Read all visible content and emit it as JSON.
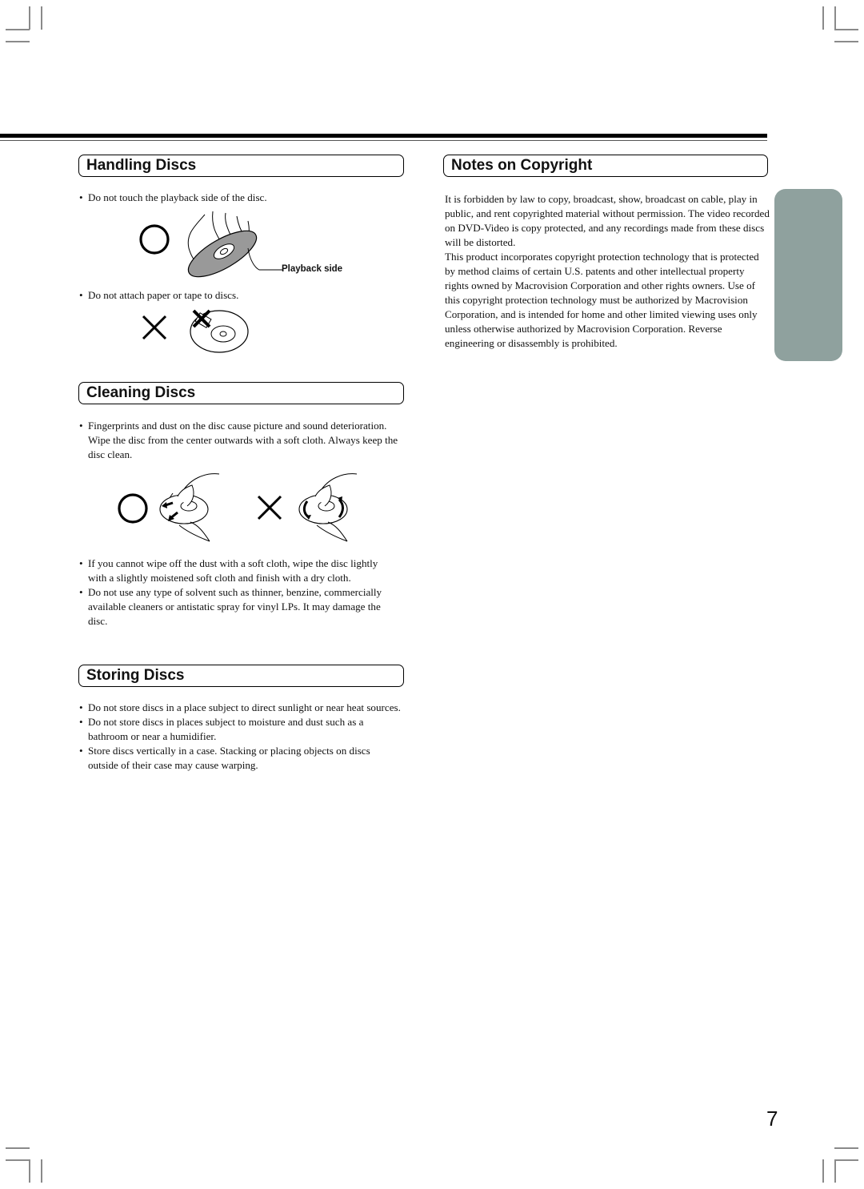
{
  "page": {
    "number": "7"
  },
  "left_column": {
    "handling": {
      "title": "Handling Discs",
      "bullet_1": "Do not touch the playback side of the disc.",
      "figure_1": {
        "ok_symbol": "circle-ok-icon",
        "label": "Playback side"
      },
      "bullet_2": "Do not attach paper or tape to discs.",
      "figure_2": {
        "ng_symbol": "cross-ng-icon"
      }
    },
    "cleaning": {
      "title": "Cleaning Discs",
      "bullets_top": [
        "Fingerprints and dust on the disc cause picture and sound deterioration. Wipe the disc from the center outwards with a soft cloth. Always keep the disc clean."
      ],
      "figure": {
        "ok_symbol": "circle-ok-icon",
        "ng_symbol": "cross-ng-icon"
      },
      "bullets_bottom": [
        "If you cannot wipe off the dust with a soft cloth, wipe the disc lightly with a slightly moistened soft cloth and finish with a dry cloth.",
        "Do not use any type of solvent such as thinner, benzine, commercially available cleaners or antistatic spray for vinyl LPs. It may damage the disc."
      ]
    },
    "storing": {
      "title": "Storing Discs",
      "bullets": [
        "Do not store discs in a place subject to direct sunlight or near heat sources.",
        "Do not store discs in places subject to moisture and dust such as a bathroom or near a humidifier.",
        "Store discs vertically in a case. Stacking or placing objects on discs outside of their case may cause warping."
      ]
    }
  },
  "right_column": {
    "copyright": {
      "title": "Notes on Copyright",
      "paragraph_1": "It is forbidden by law to copy, broadcast, show, broadcast on cable, play in public, and rent copyrighted material without permission. The video recorded on DVD-Video is copy protected, and any recordings made from these discs will be distorted.",
      "paragraph_2": "This product incorporates copyright protection technology that is protected by method claims of certain U.S. patents and other intellectual property rights owned by Macrovision Corporation and other rights owners. Use of this copyright protection technology must be authorized by Macrovision Corporation, and is intended for home and other limited viewing uses only unless otherwise authorized by Macrovision Corporation. Reverse engineering or disassembly is prohibited."
    }
  },
  "colors": {
    "side_tab": "#8fa19e",
    "text": "#111111"
  }
}
